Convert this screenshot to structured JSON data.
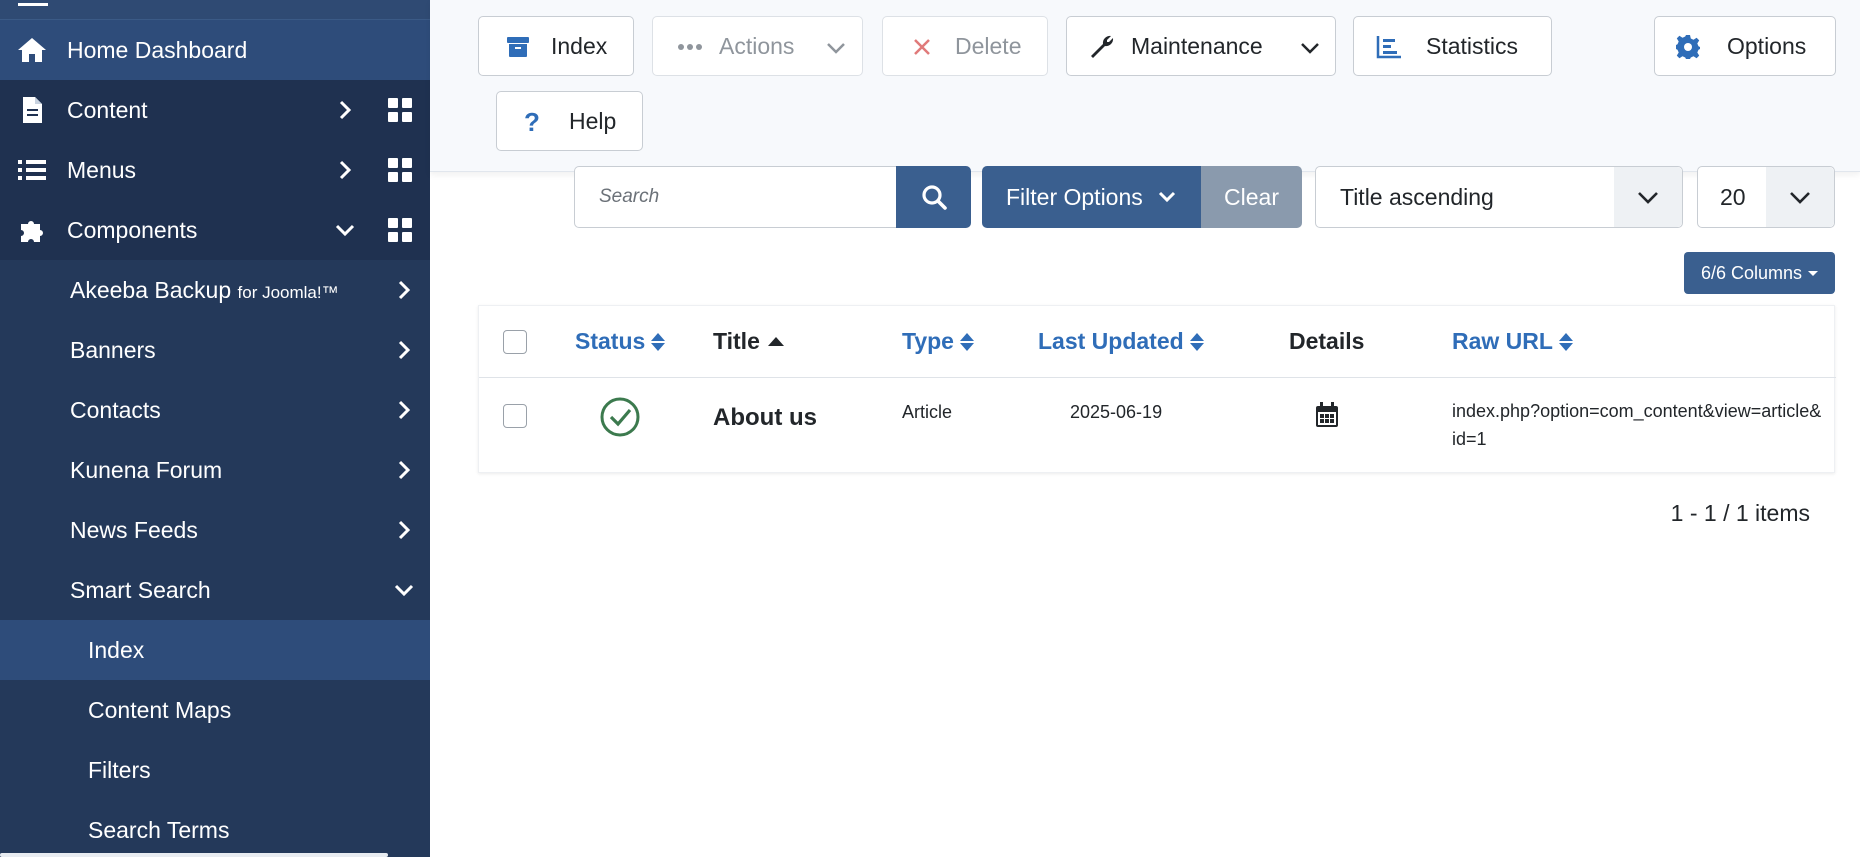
{
  "sidebar": {
    "items": [
      {
        "label": "Home Dashboard"
      },
      {
        "label": "Content"
      },
      {
        "label": "Menus"
      },
      {
        "label": "Components"
      },
      {
        "label": "Akeeba Backup",
        "label_suffix": "for Joomla!™"
      },
      {
        "label": "Banners"
      },
      {
        "label": "Contacts"
      },
      {
        "label": "Kunena Forum"
      },
      {
        "label": "News Feeds"
      },
      {
        "label": "Smart Search"
      },
      {
        "label": "Index"
      },
      {
        "label": "Content Maps"
      },
      {
        "label": "Filters"
      },
      {
        "label": "Search Terms"
      }
    ]
  },
  "toolbar": {
    "index_label": "Index",
    "actions_label": "Actions",
    "delete_label": "Delete",
    "maintenance_label": "Maintenance",
    "statistics_label": "Statistics",
    "options_label": "Options",
    "help_label": "Help"
  },
  "filters": {
    "search_placeholder": "Search",
    "filter_options_label": "Filter Options",
    "clear_label": "Clear",
    "ordering_value": "Title ascending",
    "limit_value": "20",
    "columns_label": "6/6 Columns"
  },
  "table": {
    "headers": {
      "status": "Status",
      "title": "Title",
      "type": "Type",
      "last_updated": "Last Updated",
      "details": "Details",
      "raw_url": "Raw URL"
    },
    "rows": [
      {
        "title": "About us",
        "type": "Article",
        "last_updated": "2025-06-19",
        "raw_url": "index.php?option=com_content&view=article&id=1"
      }
    ]
  },
  "pagination": {
    "summary": "1 - 1 / 1 items"
  },
  "colors": {
    "sidebar_bg": "#24395a",
    "primary": "#3a5f8f",
    "link": "#2f6db8",
    "published_green": "#3c7a4e"
  }
}
